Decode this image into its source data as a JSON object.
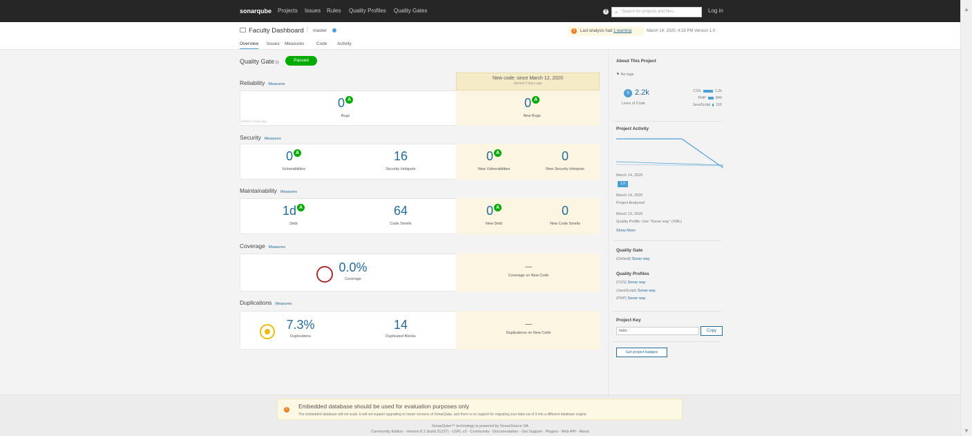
{
  "topbar": {
    "logo_main": "sonarqube",
    "nav": [
      "Projects",
      "Issues",
      "Rules",
      "Quality Profiles",
      "Quality Gates"
    ],
    "search_placeholder": "Search for projects and files...",
    "login": "Log in"
  },
  "header": {
    "project_name": "Faculty Dashboard",
    "branch": "master",
    "tabs": [
      "Overview",
      "Issues",
      "Measures",
      "Code",
      "Activity"
    ],
    "analysis_text": "Last analysis had ",
    "analysis_link": "1 warning",
    "analysis_meta": "March 14, 2020, 4:18 PM  Version 1.0"
  },
  "quality_gate": {
    "label": "Quality Gate",
    "status": "Passed"
  },
  "new_code": {
    "title": "New code: since March 12, 2020",
    "subtitle": "started 2 days ago"
  },
  "measures_link": "Measures",
  "reliability": {
    "title": "Reliability",
    "started": "started 2 days ago",
    "bugs": "0",
    "bugs_rating": "A",
    "bugs_label": "Bugs",
    "new_bugs": "0",
    "new_bugs_rating": "A",
    "new_bugs_label": "New Bugs"
  },
  "security": {
    "title": "Security",
    "vulns": "0",
    "vulns_rating": "A",
    "vulns_label": "Vulnerabilities",
    "hotspots": "16",
    "hotspots_label": "Security Hotspots",
    "new_vulns": "0",
    "new_vulns_rating": "A",
    "new_vulns_label": "New Vulnerabilities",
    "new_hotspots": "0",
    "new_hotspots_label": "New Security Hotspots"
  },
  "maintainability": {
    "title": "Maintainability",
    "debt": "1d",
    "debt_rating": "A",
    "debt_label": "Debt",
    "smells": "64",
    "smells_label": "Code Smells",
    "new_debt": "0",
    "new_debt_rating": "A",
    "new_debt_label": "New Debt",
    "new_smells": "0",
    "new_smells_label": "New Code Smells"
  },
  "coverage": {
    "title": "Coverage",
    "value": "0.0%",
    "label": "Coverage",
    "new_value": "—",
    "new_label": "Coverage on New Code"
  },
  "duplications": {
    "title": "Duplications",
    "value": "7.3%",
    "label": "Duplications",
    "blocks": "14",
    "blocks_label": "Duplicated Blocks",
    "new_value": "—",
    "new_label": "Duplications on New Code"
  },
  "sidebar": {
    "about_title": "About This Project",
    "tags": "No tags",
    "loc_badge": "S",
    "loc": "2.2k",
    "loc_label": "Lines of Code",
    "langs": [
      {
        "name": "CSS",
        "value": "1.2k"
      },
      {
        "name": "PHP",
        "value": "840"
      },
      {
        "name": "JavaScript",
        "value": "115"
      }
    ],
    "activity_title": "Project Activity",
    "events": [
      {
        "date": "March 14, 2020",
        "tag": "1.0"
      },
      {
        "date": "March 14, 2020",
        "text": "Project Analyzed"
      },
      {
        "date": "March 13, 2020",
        "text": "Quality Profile: Use \"Sonar way\" (XML)"
      }
    ],
    "show_more": "Show More",
    "qg_title": "Quality Gate",
    "qg_default": "(Default)",
    "qg_link": "Sonar way",
    "qp_title": "Quality Profiles",
    "profiles": [
      {
        "lang": "(CSS)",
        "name": "Sonar way"
      },
      {
        "lang": "(JavaScript)",
        "name": "Sonar way"
      },
      {
        "lang": "(PHP)",
        "name": "Sonar way"
      }
    ],
    "key_title": "Project Key",
    "key_value": "hello",
    "copy": "Copy",
    "badges": "Get project badges"
  },
  "footer": {
    "warn_title": "Embedded database should be used for evaluation purposes only",
    "warn_text": "The embedded database will not scale, it will not support upgrading to newer versions of SonarQube, and there is no support for migrating your data out of it into a different database engine.",
    "powered": "SonarQube™ technology is powered by SonarSource SA",
    "links": "Community Edition - Version 8.1 (build 31237) - LGPL v3 - Community - Documentation - Get Support - Plugins - Web API - About"
  },
  "colors": {
    "topbar": "#262626",
    "accent": "#236a97",
    "passed": "#00aa00",
    "newcode": "#fcf5e2"
  }
}
